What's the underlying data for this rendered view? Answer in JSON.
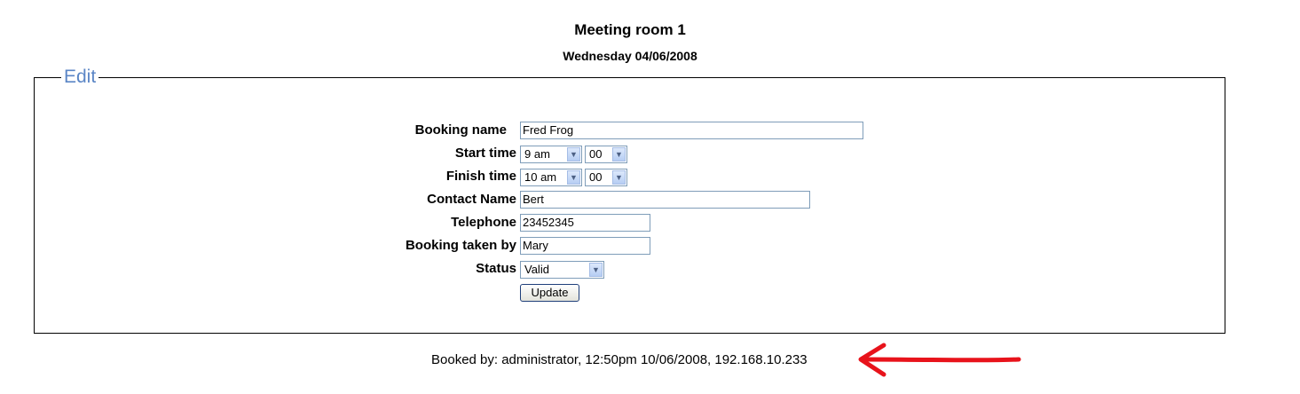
{
  "header": {
    "room": "Meeting room 1",
    "date": "Wednesday 04/06/2008"
  },
  "form": {
    "legend": "Edit",
    "booking_name_label": "Booking name",
    "booking_name_value": "Fred Frog",
    "start_time_label": "Start time",
    "start_hour": "9 am",
    "start_minute": "00",
    "finish_time_label": "Finish time",
    "finish_hour": "10 am",
    "finish_minute": "00",
    "contact_name_label": "Contact Name",
    "contact_name_value": "Bert",
    "telephone_label": "Telephone",
    "telephone_value": "23452345",
    "taken_by_label": "Booking taken by",
    "taken_by_value": "Mary",
    "status_label": "Status",
    "status_value": "Valid",
    "update_label": "Update"
  },
  "footer": {
    "booked_by": "Booked by: administrator, 12:50pm 10/06/2008, 192.168.10.233"
  },
  "colors": {
    "legend": "#5b86c6",
    "arrow": "#e8131b"
  },
  "icons": {
    "dropdown": "chevron-down-icon",
    "annotation": "red-arrow-icon"
  }
}
